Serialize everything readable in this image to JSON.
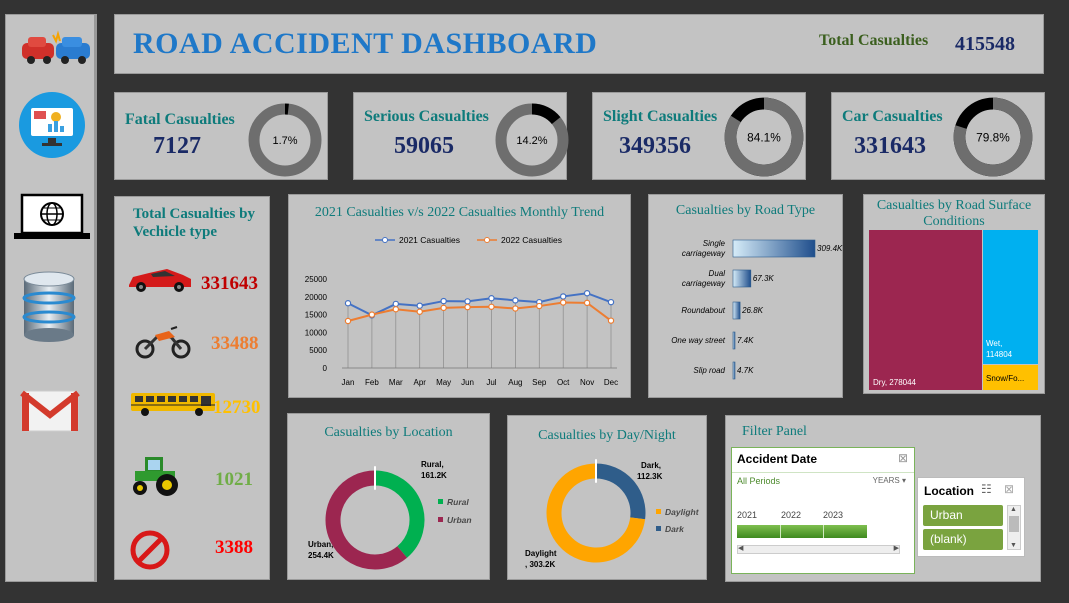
{
  "dashboard": {
    "title": "ROAD ACCIDENT DASHBOARD",
    "total_label": "Total Casualties",
    "total_value": "415548"
  },
  "sidebar": {
    "items": [
      {
        "icon": "car-crash-icon"
      },
      {
        "icon": "dashboard-monitor-icon"
      },
      {
        "icon": "globe-laptop-icon"
      },
      {
        "icon": "database-icon"
      },
      {
        "icon": "mail-icon"
      }
    ]
  },
  "kpis": [
    {
      "label": "Fatal Casualties",
      "value": "7127",
      "pct": "1.7%",
      "fraction": 0.017,
      "ring_color": "#000000",
      "track_color": "#6e6e6e"
    },
    {
      "label": "Serious Casualties",
      "value": "59065",
      "pct": "14.2%",
      "fraction": 0.142,
      "ring_color": "#000000",
      "track_color": "#6e6e6e"
    },
    {
      "label": "Slight Casualties",
      "value": "349356",
      "pct": "84.1%",
      "fraction": 0.841,
      "ring_color": "#6e6e6e",
      "track_color": "#000000"
    },
    {
      "label": "Car Casualties",
      "value": "331643",
      "pct": "79.8%",
      "fraction": 0.798,
      "ring_color": "#6e6e6e",
      "track_color": "#000000"
    }
  ],
  "vehicle": {
    "title_line1": "Total Casualties by",
    "title_line2": "Vechicle type",
    "items": [
      {
        "icon": "car-icon",
        "value": "331643",
        "color": "#c00000"
      },
      {
        "icon": "motorcycle-icon",
        "value": "33488",
        "color": "#ed7d31"
      },
      {
        "icon": "bus-icon",
        "value": "12730",
        "color": "#ffc000"
      },
      {
        "icon": "tractor-icon",
        "value": "1021",
        "color": "#70ad47"
      },
      {
        "icon": "prohibited-icon",
        "value": "3388",
        "color": "#ff0000"
      }
    ]
  },
  "trend": {
    "title": "2021 Casualties v/s 2022 Casualties Monthly Trend",
    "legend1": "2021 Casualties",
    "legend2": "2022 Casualties"
  },
  "road_type": {
    "title": "Casualties by Road Type"
  },
  "surface": {
    "title_line1": "Casualties by Road Surface",
    "title_line2": "Conditions"
  },
  "location": {
    "title": "Casualties by Location"
  },
  "daynight": {
    "title": "Casualties by Day/Night"
  },
  "filter": {
    "title": "Filter Panel",
    "date_header": "Accident Date",
    "all_periods": "All Periods",
    "years_dropdown": "YEARS",
    "years": [
      "2021",
      "2022",
      "2023"
    ],
    "location_header": "Location",
    "location_options": [
      "Urban",
      "(blank)"
    ]
  },
  "chart_data": [
    {
      "type": "line",
      "title": "2021 Casualties v/s 2022 Casualties Monthly Trend",
      "categories": [
        "Jan",
        "Feb",
        "Mar",
        "Apr",
        "May",
        "Jun",
        "Jul",
        "Aug",
        "Sep",
        "Oct",
        "Nov",
        "Dec"
      ],
      "series": [
        {
          "name": "2021 Casualties",
          "color": "#4472c4",
          "values": [
            18200,
            14800,
            18000,
            17500,
            18800,
            18700,
            19600,
            19000,
            18500,
            20100,
            21000,
            18500
          ]
        },
        {
          "name": "2022 Casualties",
          "color": "#ed7d31",
          "values": [
            13200,
            15000,
            16500,
            15800,
            16900,
            17100,
            17200,
            16700,
            17400,
            18400,
            18300,
            13300
          ]
        }
      ],
      "yticks": [
        "0",
        "5000",
        "10000",
        "15000",
        "20000",
        "25000"
      ],
      "ylim": [
        0,
        25000
      ],
      "grid": false,
      "legend": "top"
    },
    {
      "type": "bar",
      "title": "Casualties by Road Type",
      "categories": [
        "Single carriageway",
        "Dual carriageway",
        "Roundabout",
        "One way street",
        "Slip road"
      ],
      "values": [
        309400,
        67300,
        26800,
        7400,
        4700
      ],
      "labels": [
        "309.4K",
        "67.3K",
        "26.8K",
        "7.4K",
        "4.7K"
      ],
      "orientation": "horizontal"
    },
    {
      "type": "heatmap",
      "title": "Casualties by Road Surface Conditions",
      "cells": [
        {
          "name": "Dry",
          "value": 278044,
          "label": "Dry, 278044",
          "color": "#9c2650"
        },
        {
          "name": "Wet",
          "value": 114804,
          "label": "Wet, 114804",
          "color": "#00b0f0"
        },
        {
          "name": "Snow/Fo...",
          "value": 22700,
          "label": "Snow/Fo...",
          "color": "#ffc000"
        }
      ]
    },
    {
      "type": "pie",
      "title": "Casualties by Location",
      "slices": [
        {
          "name": "Rural",
          "value": 161200,
          "label": "161.2K",
          "color": "#00b050"
        },
        {
          "name": "Urban",
          "value": 254400,
          "label": "254.4K",
          "color": "#9c2650"
        }
      ],
      "legend": "right"
    },
    {
      "type": "pie",
      "title": "Casualties by Day/Night",
      "slices": [
        {
          "name": "Dark",
          "value": 112300,
          "label": "112.3K",
          "color": "#2f5d8a"
        },
        {
          "name": "Daylight",
          "value": 303200,
          "label": "303.2K",
          "color": "#ffa500"
        }
      ],
      "legend": "right"
    }
  ]
}
